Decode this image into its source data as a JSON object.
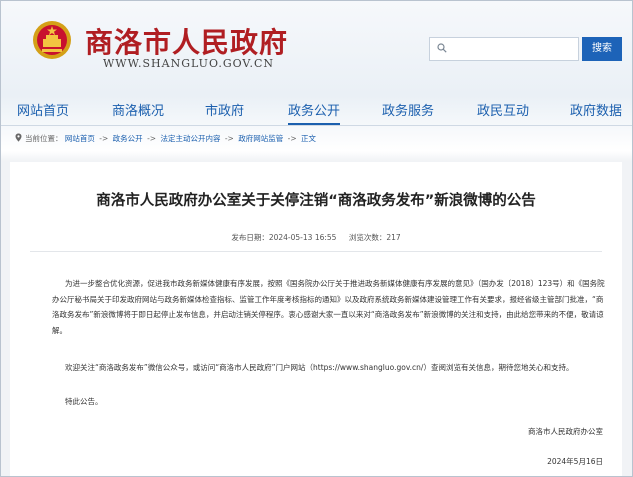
{
  "header": {
    "site_title": "商洛市人民政府",
    "site_url": "WWW.SHANGLUO.GOV.CN",
    "search_placeholder": "",
    "search_button": "搜索",
    "brand_red": "#b01e22",
    "brand_blue": "#1d63b8"
  },
  "nav": {
    "items": [
      "网站首页",
      "商洛概况",
      "市政府",
      "政务公开",
      "政务服务",
      "政民互动",
      "政府数据"
    ],
    "active": "政务公开"
  },
  "breadcrumb": {
    "prefix": "当前位置：",
    "items": [
      "网站首页",
      "政务公开",
      "法定主动公开内容",
      "政府网站监管",
      "正文"
    ],
    "separator": "->"
  },
  "article": {
    "title": "商洛市人民政府办公室关于关停注销“商洛政务发布”新浪微博的公告",
    "publish_date": "发布日期：2024-05-13 16:55",
    "views": "浏览次数：217",
    "paragraphs": [
      "为进一步整合优化资源，促进我市政务新媒体健康有序发展，按照《国务院办公厅关于推进政务新媒体健康有序发展的意见》（国办发〔2018〕123号）和《国务院办公厅秘书局关于印发政府网站与政务新媒体检查指标、监管工作年度考核指标的通知》以及政府系统政务新媒体建设管理工作有关要求，报经省级主管部门批准，“商洛政务发布”新浪微博将于即日起停止发布信息，并启动注销关停程序。衷心感谢大家一直以来对“商洛政务发布”新浪微博的关注和支持，由此给您带来的不便，敬请谅解。",
      "欢迎关注“商洛政务发布”微信公众号，或访问“商洛市人民政府”门户网站（https://www.shangluo.gov.cn/）查阅浏览有关信息，期待您地关心和支持。",
      "特此公告。"
    ],
    "signature": "商洛市人民政府办公室",
    "date": "2024年5月16日"
  }
}
